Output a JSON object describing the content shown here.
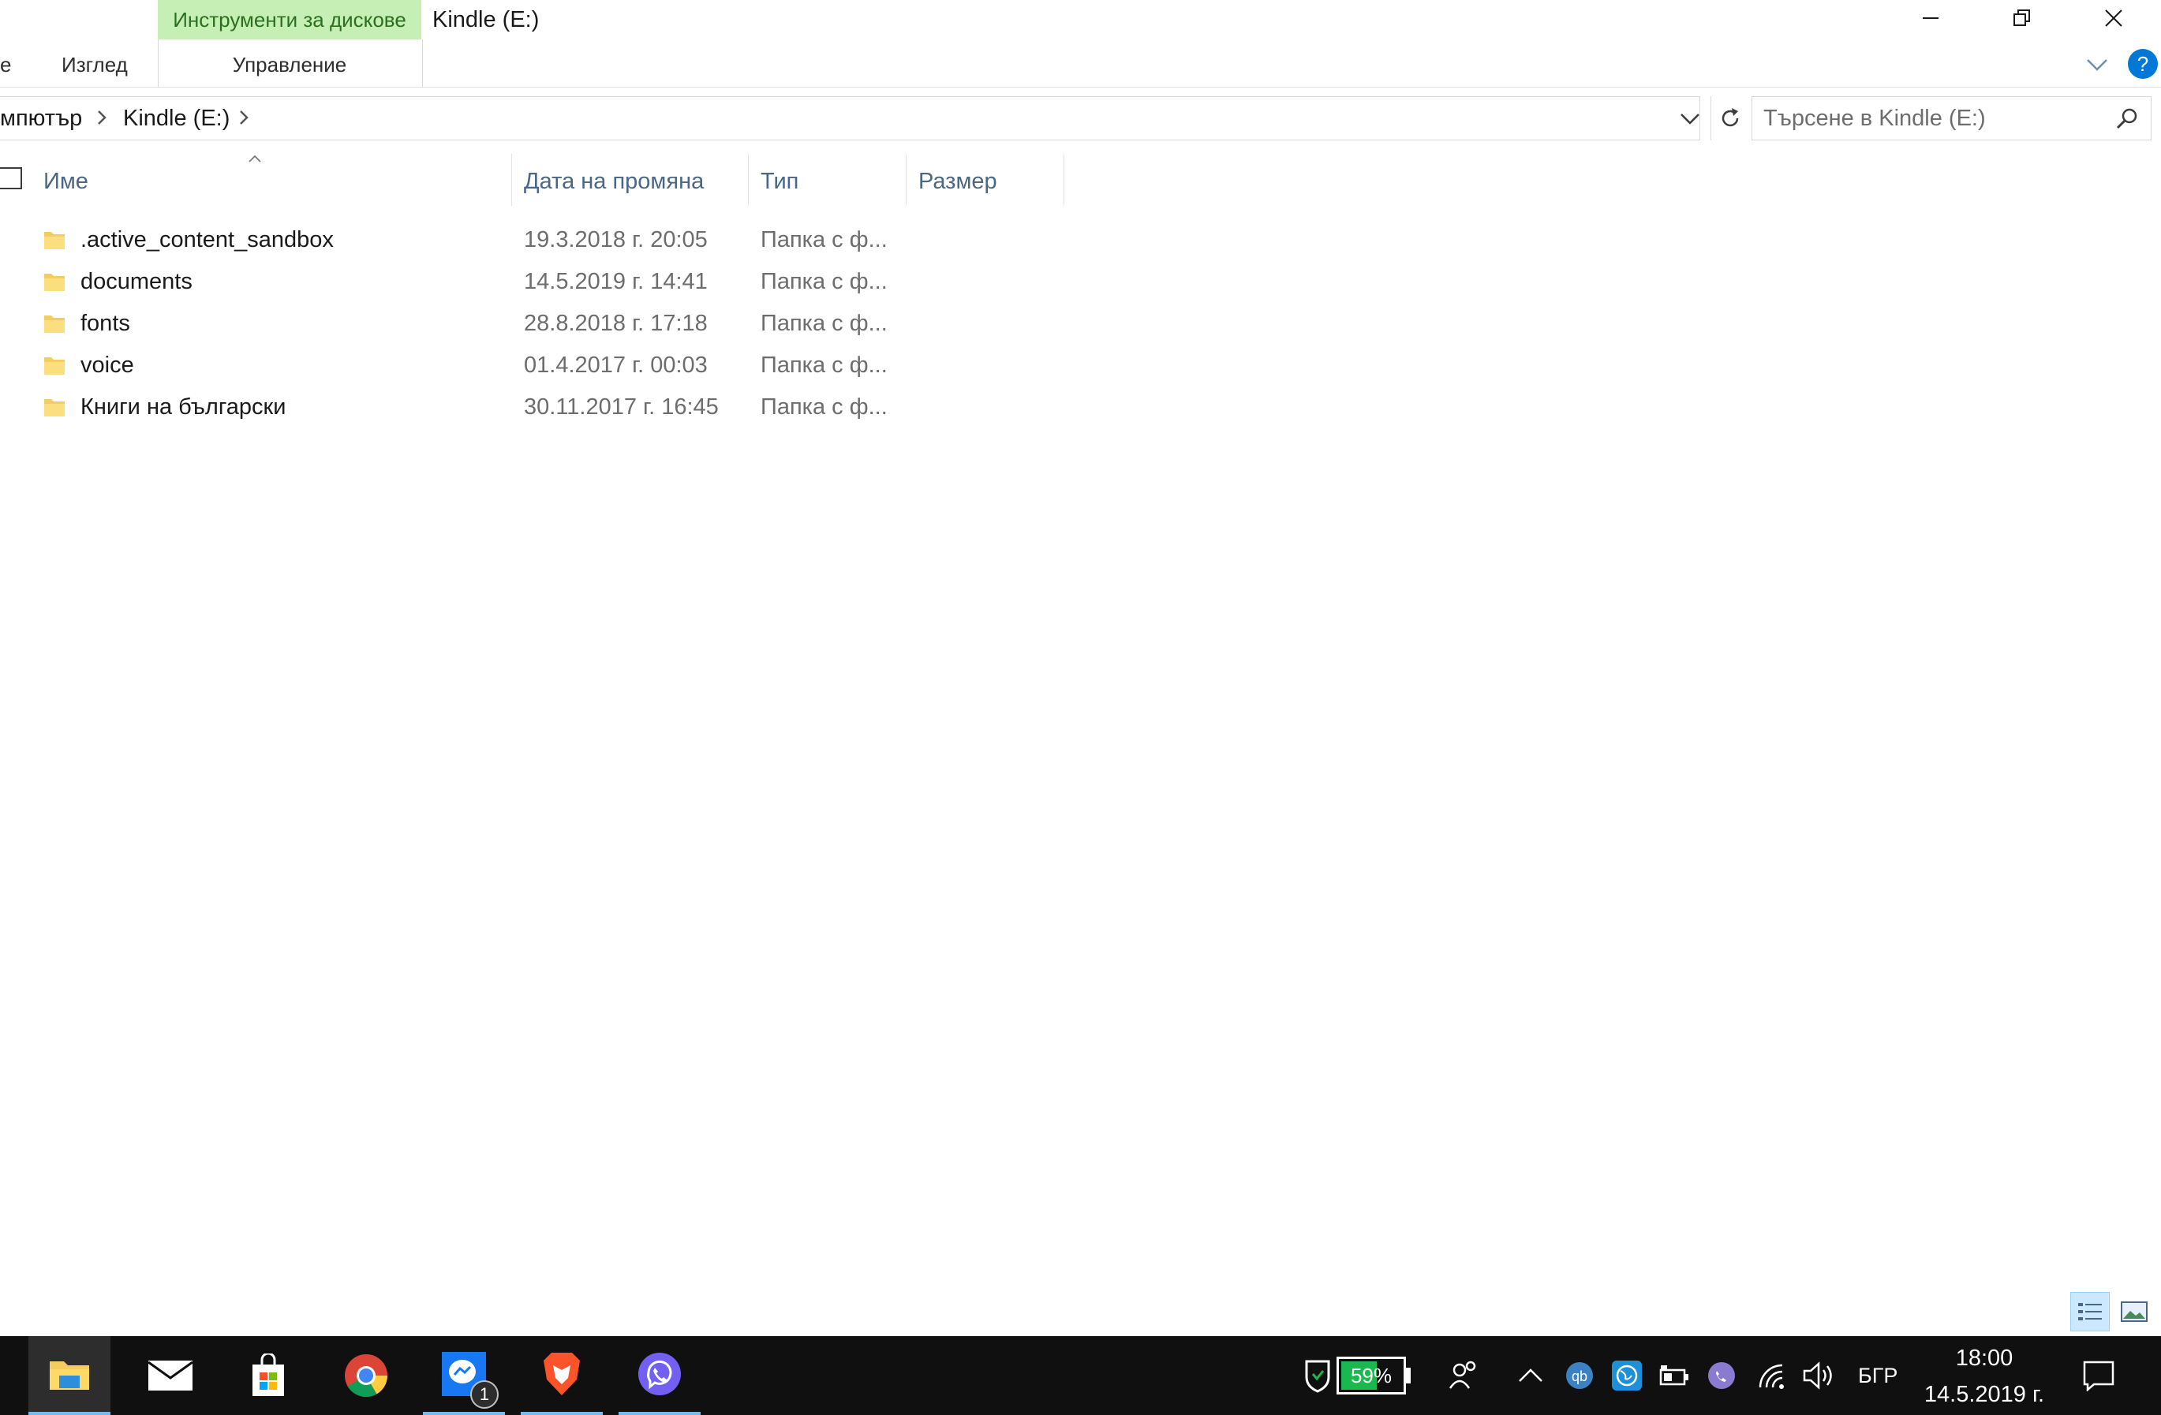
{
  "window": {
    "title": "Kindle (E:)",
    "context_tab": "Инструменти за дискове",
    "context_sub_tab": "Управление",
    "ribbon_tabs": [
      "е",
      "Изглед"
    ]
  },
  "address": {
    "crumbs": [
      "мпютър",
      "Kindle (E:)"
    ],
    "search_placeholder": "Търсене в Kindle (E:)"
  },
  "columns": [
    "Име",
    "Дата на промяна",
    "Тип",
    "Размер"
  ],
  "files": [
    {
      "name": ".active_content_sandbox",
      "date": "19.3.2018 г. 20:05",
      "type": "Папка с ф..."
    },
    {
      "name": "documents",
      "date": "14.5.2019 г. 14:41",
      "type": "Папка с ф..."
    },
    {
      "name": "fonts",
      "date": "28.8.2018 г. 17:18",
      "type": "Папка с ф..."
    },
    {
      "name": "voice",
      "date": "01.4.2017 г. 00:03",
      "type": "Папка с ф..."
    },
    {
      "name": "Книги на български",
      "date": "30.11.2017 г. 16:45",
      "type": "Папка с ф..."
    }
  ],
  "taskbar": {
    "apps": [
      "file-explorer",
      "mail",
      "microsoft-store",
      "chrome",
      "messenger",
      "brave",
      "viber"
    ],
    "messenger_badge": "1",
    "battery_percent": "59%",
    "battery_level": 0.59,
    "language": "БГР",
    "time": "18:00",
    "date": "14.5.2019 г."
  },
  "colors": {
    "context_tab_bg": "#c6efb5",
    "folder_yellow": "#f5cd5c",
    "taskbar_bg": "#101010",
    "accent_blue": "#0078d7",
    "battery_green": "#1bb84f"
  }
}
